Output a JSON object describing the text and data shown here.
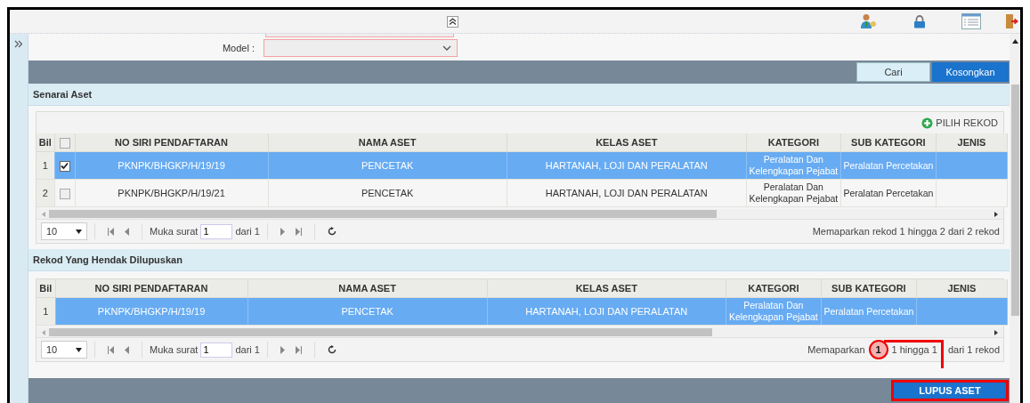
{
  "filter": {
    "label": "Model :",
    "invalid": true
  },
  "actions": [
    {
      "label": "Cari",
      "kind": "secondary"
    },
    {
      "label": "Kosongkan",
      "kind": "primary"
    }
  ],
  "grids": [
    {
      "title": "Senarai Aset",
      "toolbar": {
        "label": "PILIH REKOD"
      },
      "checkbox_column": true,
      "header_checked": false,
      "columns": [
        "Bil",
        "NO SIRI PENDAFTARAN",
        "NAMA ASET",
        "KELAS ASET",
        "KATEGORI",
        "SUB KATEGORI",
        "JENIS"
      ],
      "rows": [
        {
          "selected": true,
          "checked": true,
          "cells": [
            "1",
            "PKNPK/BHGKP/H/19/19",
            "PENCETAK",
            "HARTANAH, LOJI DAN PERALATAN",
            "Peralatan Dan Kelengkapan Pejabat",
            "Peralatan Percetakan"
          ]
        },
        {
          "selected": false,
          "checked": false,
          "cells": [
            "2",
            "PKNPK/BHGKP/H/19/21",
            "PENCETAK",
            "HARTANAH, LOJI DAN PERALATAN",
            "Peralatan Dan Kelengkapan Pejabat",
            "Peralatan Percetakan"
          ]
        }
      ],
      "pager": {
        "page_size": "10",
        "page_label": "Muka surat",
        "page": "1",
        "of_label": "dari 1",
        "info": [
          {
            "kind": "text",
            "text": "Memaparkan rekod 1 hingga 2 dari 2 rekod"
          }
        ]
      }
    },
    {
      "title": "Rekod Yang Hendak Dilupuskan",
      "checkbox_column": false,
      "columns": [
        "Bil",
        "NO SIRI PENDAFTARAN",
        "NAMA ASET",
        "KELAS ASET",
        "KATEGORI",
        "SUB KATEGORI",
        "JENIS"
      ],
      "rows": [
        {
          "selected": true,
          "cells": [
            "1",
            "PKNPK/BHGKP/H/19/19",
            "PENCETAK",
            "HARTANAH, LOJI DAN PERALATAN",
            "Peralatan Dan Kelengkapan Pejabat",
            "Peralatan Percetakan"
          ]
        }
      ],
      "pager": {
        "page_size": "10",
        "page_label": "Muka surat",
        "page": "1",
        "of_label": "dari 1",
        "info": [
          {
            "kind": "text",
            "text": "Memaparkan"
          },
          {
            "kind": "callout",
            "text": "1"
          },
          {
            "kind": "text",
            "text": "1 hingga 1"
          },
          {
            "kind": "leader"
          },
          {
            "kind": "text",
            "text": "dari 1 rekod"
          }
        ]
      }
    }
  ],
  "submit": {
    "label": "LUPUS ASET",
    "highlighted": true
  }
}
